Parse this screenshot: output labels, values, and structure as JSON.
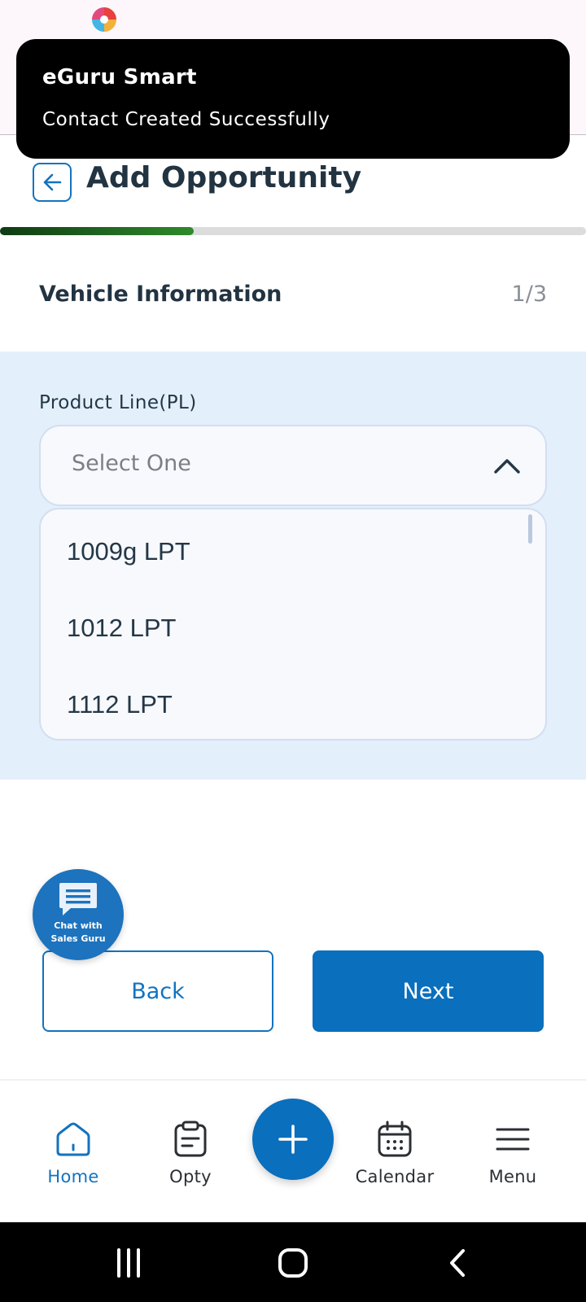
{
  "toast": {
    "title": "eGuru Smart",
    "message": "Contact Created Successfully"
  },
  "header": {
    "title": "Add Opportunity",
    "back_icon": "arrow-left-icon"
  },
  "progress": {
    "fraction": 0.33,
    "color": "#2e8b2a"
  },
  "section": {
    "title": "Vehicle Information",
    "step": "1/3"
  },
  "form": {
    "product_line": {
      "label": "Product Line(PL)",
      "placeholder": "Select One",
      "expanded": true,
      "options": [
        "1009g LPT",
        "1012 LPT",
        "1112 LPT"
      ]
    }
  },
  "chat_fab": {
    "label": "Chat with Sales Guru",
    "icon": "chat-icon"
  },
  "buttons": {
    "back": "Back",
    "next": "Next"
  },
  "bottom_nav": {
    "items": [
      {
        "label": "Home",
        "icon": "home-icon",
        "active": true
      },
      {
        "label": "Opty",
        "icon": "clipboard-icon",
        "active": false
      },
      {
        "label": "Calendar",
        "icon": "calendar-icon",
        "active": false
      },
      {
        "label": "Menu",
        "icon": "menu-icon",
        "active": false
      }
    ],
    "add_icon": "plus-icon"
  },
  "colors": {
    "primary": "#0a6fbd",
    "panel": "#e3f0fb",
    "progress_dark": "#0f3b14",
    "progress_light": "#2e8b2a"
  }
}
